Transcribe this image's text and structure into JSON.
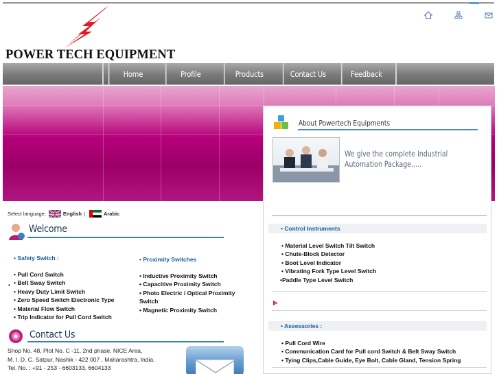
{
  "header": {
    "company_name": "POWER TECH EQUIPMENT",
    "logo_icon": "lightning-bolt-icon",
    "top_icons": [
      "home-icon",
      "sitemap-icon",
      "mail-icon"
    ]
  },
  "nav": {
    "items": [
      {
        "label": "Home"
      },
      {
        "label": "Profile"
      },
      {
        "label": "Products"
      },
      {
        "label": "Contact Us"
      },
      {
        "label": "Feedback"
      }
    ]
  },
  "language": {
    "label": "Select language:",
    "options": [
      "English",
      "Arabic"
    ],
    "separator": "|"
  },
  "welcome": {
    "heading": "Welcome",
    "safety": {
      "title": "• Safety Switch :",
      "items": [
        "• Pull Cord Switch",
        "• Belt Sway Switch",
        "• Heavy Duty Limit Switch",
        "• Zero Speed Switch Electronic Type",
        "• Material Flow Switch",
        "• Trip Indicator for Pull Cord Switch"
      ]
    },
    "proximity": {
      "title": "• Proximity Switches",
      "items": [
        "• Inductive Proximity Switch",
        "• Capacitive Proximity Switch",
        "• Photo Electric / Optical Proximity Switch",
        "• Magnetic Proximity Switch"
      ]
    }
  },
  "contact": {
    "heading": "Contact Us",
    "lines": [
      "Shop No. 48, Plot No. C -11, 2nd phase, NICE Area,",
      "M. I. D. C. Satpur, Nashik - 422 007 , Maharashtra, India.",
      "Tel. No. : +91 - 253 - 6603133, 6604133"
    ]
  },
  "about": {
    "title": "About Powertech Equipments",
    "text": "We give the complete Industrial Automation Package.....",
    "control": {
      "title": "• Control Instruments",
      "items": [
        "• Material Level Switch Tilt Switch",
        "• Chute-Block Detector",
        "• Boot Level Indicator",
        "• Vibrating Fork Type Level Switch",
        "•Paddle Type Level Switch"
      ]
    },
    "accessories": {
      "title": "• Assessories :",
      "items": [
        "• Pull Cord Wire",
        "• Communication Card for Pull cord Switch & Belt Sway Switch",
        "• Tying Clips,Cable Guide, Eye Bolt, Cable Gland, Tension Spring"
      ]
    }
  },
  "colors": {
    "banner": "#b5007a",
    "accent_blue": "#1a5c96",
    "nav_bg": "#7a7a7a"
  }
}
